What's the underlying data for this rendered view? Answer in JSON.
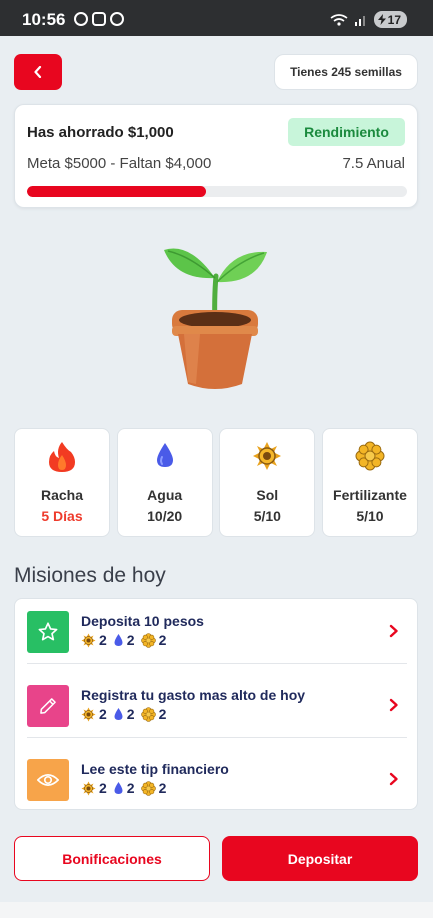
{
  "status_bar": {
    "time": "10:56",
    "battery": "17"
  },
  "header": {
    "back_icon": "chevron-left-icon",
    "seeds_label": "Tienes 245 semillas"
  },
  "savings": {
    "saved_label": "Has ahorrado $1,000",
    "yield_badge": "Rendimiento",
    "goal_label": "Meta $5000 - Faltan $4,000",
    "rate_label": "7.5 Anual",
    "progress_fraction": 0.47,
    "accent_color": "#e8061f"
  },
  "plant": {
    "icon": "potted-plant-icon"
  },
  "stats": [
    {
      "icon": "flame-icon",
      "label": "Racha",
      "value": "5 Días"
    },
    {
      "icon": "water-drop-icon",
      "label": "Agua",
      "value": "10/20"
    },
    {
      "icon": "sun-icon",
      "label": "Sol",
      "value": "5/10"
    },
    {
      "icon": "flower-icon",
      "label": "Fertilizante",
      "value": "5/10"
    }
  ],
  "missions": {
    "title": "Misiones de hoy",
    "items": [
      {
        "title": "Deposita 10 pesos",
        "icon": "star-icon",
        "color": "#28bf64",
        "sun": "2",
        "water": "2",
        "fertilizer": "2"
      },
      {
        "title": "Registra tu gasto mas alto de hoy",
        "icon": "pencil-icon",
        "color": "#e8448a",
        "sun": "2",
        "water": "2",
        "fertilizer": "2"
      },
      {
        "title": "Lee este tip financiero",
        "icon": "eye-icon",
        "color": "#f7a44a",
        "sun": "2",
        "water": "2",
        "fertilizer": "2"
      }
    ]
  },
  "actions": {
    "bonus_label": "Bonificaciones",
    "deposit_label": "Depositar"
  }
}
